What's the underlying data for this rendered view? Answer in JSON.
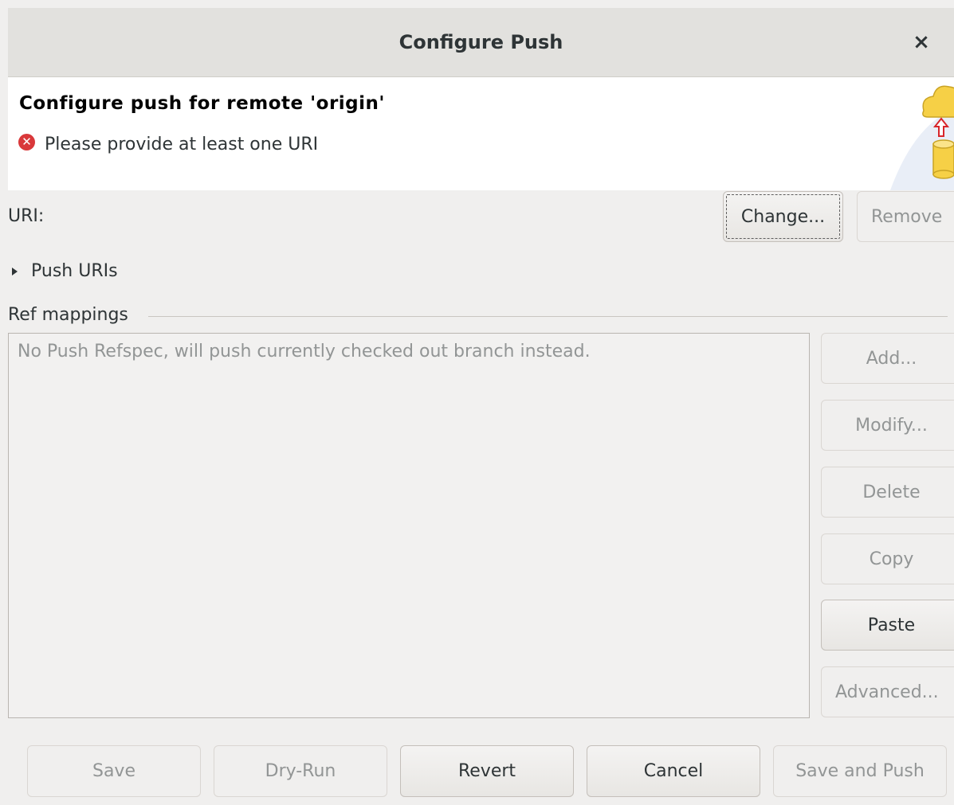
{
  "window": {
    "title": "Configure Push",
    "close_symbol": "×"
  },
  "banner": {
    "heading": "Configure push for remote 'origin'",
    "error_message": "Please provide at least one URI",
    "error_icon_symbol": "✕"
  },
  "uri": {
    "label": "URI:",
    "change_label": "Change...",
    "remove_label": "Remove"
  },
  "push_uris": {
    "label": "Push URIs",
    "expanded": false
  },
  "ref_mappings": {
    "group_label": "Ref mappings",
    "empty_text": "No Push Refspec, will push currently checked out branch instead.",
    "buttons": {
      "add": "Add...",
      "modify": "Modify...",
      "delete": "Delete",
      "copy": "Copy",
      "paste": "Paste",
      "advanced": "Advanced..."
    }
  },
  "footer": {
    "save": "Save",
    "dry_run": "Dry-Run",
    "revert": "Revert",
    "cancel": "Cancel",
    "save_and_push": "Save and Push"
  },
  "colors": {
    "error_red": "#d9383a",
    "cloud_yellow": "#f6d046",
    "arrow_red": "#d8262b"
  }
}
